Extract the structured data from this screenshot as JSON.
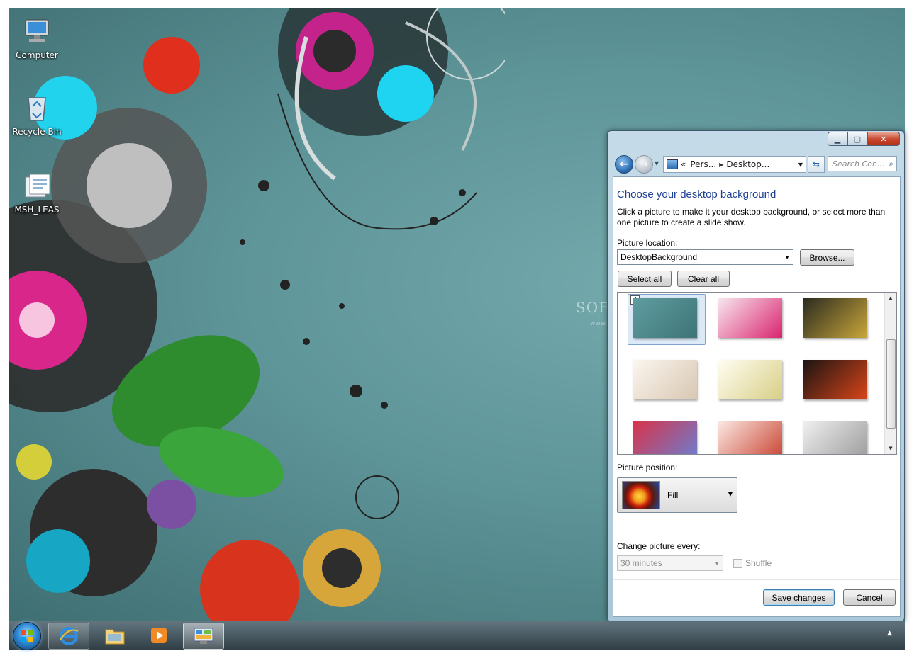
{
  "desktop": {
    "icons": [
      {
        "label": "Computer",
        "icon": "computer-icon"
      },
      {
        "label": "Recycle Bin",
        "icon": "recycle-bin-icon"
      },
      {
        "label": "MSH_LEAS",
        "icon": "document-icon"
      }
    ]
  },
  "window": {
    "caption_buttons": {
      "minimize": "minimize-icon",
      "maximize": "maximize-icon",
      "close": "close-icon"
    },
    "address": {
      "overflow": "«",
      "crumbs": [
        "Pers...",
        "Desktop..."
      ]
    },
    "search_placeholder": "Search Con...",
    "title": "Choose your desktop background",
    "description": "Click a picture to make it your desktop background, or select more than one picture to create a slide show.",
    "picture_location": {
      "label": "Picture location:",
      "value": "DesktopBackground",
      "browse": "Browse..."
    },
    "select_all": "Select all",
    "clear_all": "Clear all",
    "thumbnails": [
      {
        "name": "teal-texture",
        "selected": true,
        "colors": [
          "#5f9da0",
          "#3e7477"
        ]
      },
      {
        "name": "pink-floral",
        "selected": false,
        "colors": [
          "#f8e7ef",
          "#d9246e"
        ]
      },
      {
        "name": "gold-abstract",
        "selected": false,
        "colors": [
          "#2b2b20",
          "#c8a63a"
        ]
      },
      {
        "name": "beige-ornament",
        "selected": false,
        "colors": [
          "#fbf6ef",
          "#d8c7b2"
        ]
      },
      {
        "name": "cream-floral",
        "selected": false,
        "colors": [
          "#fffdf2",
          "#d8cf86"
        ]
      },
      {
        "name": "confetti-dark",
        "selected": false,
        "colors": [
          "#1b1412",
          "#d8451a"
        ]
      },
      {
        "name": "red-blue-paint",
        "selected": false,
        "colors": [
          "#d8344a",
          "#6a7fd2"
        ]
      },
      {
        "name": "red-pattern",
        "selected": false,
        "colors": [
          "#fbe8e2",
          "#c8402e"
        ]
      },
      {
        "name": "gray-sketch",
        "selected": false,
        "colors": [
          "#efefef",
          "#9a9a9a"
        ]
      }
    ],
    "picture_position": {
      "label": "Picture position:",
      "value": "Fill"
    },
    "change_picture": {
      "label": "Change picture every:",
      "value": "30 minutes"
    },
    "shuffle": "Shuffle",
    "save": "Save changes",
    "cancel": "Cancel"
  },
  "watermark": {
    "text": "SOFTPEDIA",
    "url": "www.softpedia.com"
  },
  "taskbar": {
    "items": [
      "internet-explorer-icon",
      "windows-explorer-icon",
      "media-player-icon",
      "control-panel-icon"
    ],
    "tray": "▲"
  }
}
